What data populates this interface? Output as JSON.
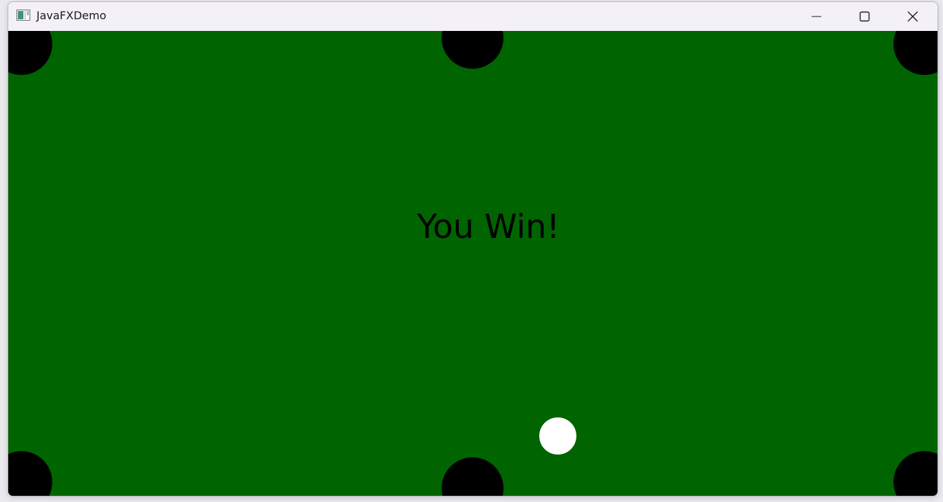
{
  "window": {
    "title": "JavaFXDemo",
    "icon": "java-app-icon",
    "controls": {
      "minimize_icon": "minimize-icon",
      "maximize_icon": "maximize-icon",
      "close_icon": "close-icon"
    }
  },
  "game": {
    "message": "You Win!",
    "table_color": "#006400",
    "pocket_color": "#000000",
    "cue_ball_color": "#ffffff"
  }
}
